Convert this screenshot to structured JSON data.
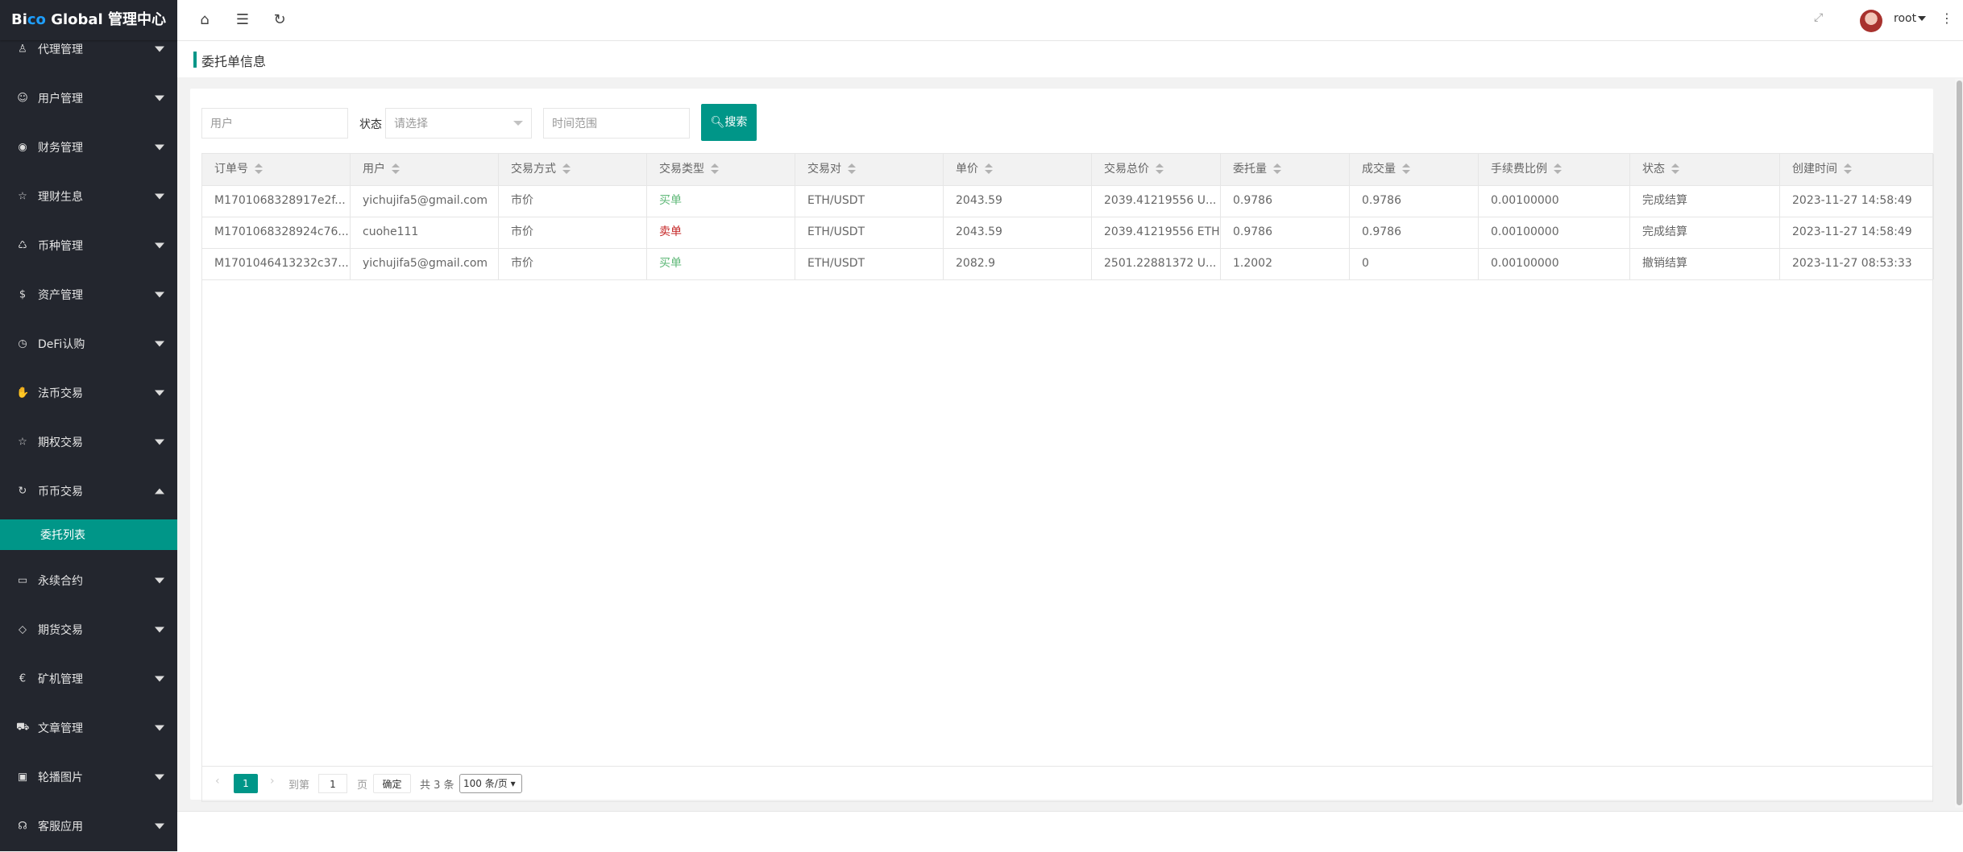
{
  "app": {
    "logo_prefix": "Bi",
    "logo_accent": "co",
    "logo_suffix": " Global 管理中心",
    "user": "root"
  },
  "sidebar": {
    "items": [
      {
        "label": "代理管理",
        "icon": "user-icon"
      },
      {
        "label": "用户管理",
        "icon": "users-icon"
      },
      {
        "label": "财务管理",
        "icon": "finance-icon"
      },
      {
        "label": "理财生息",
        "icon": "star-icon"
      },
      {
        "label": "币种管理",
        "icon": "coin-icon"
      },
      {
        "label": "资产管理",
        "icon": "dollar-icon"
      },
      {
        "label": "DeFi认购",
        "icon": "clock-icon"
      },
      {
        "label": "法币交易",
        "icon": "hand-icon"
      },
      {
        "label": "期权交易",
        "icon": "star-icon"
      },
      {
        "label": "币币交易",
        "icon": "refresh-icon",
        "expanded": true
      },
      {
        "label": "永续合约",
        "icon": "document-icon"
      },
      {
        "label": "期货交易",
        "icon": "diamond-icon"
      },
      {
        "label": "矿机管理",
        "icon": "euro-icon"
      },
      {
        "label": "文章管理",
        "icon": "car-icon"
      },
      {
        "label": "轮播图片",
        "icon": "image-icon"
      },
      {
        "label": "客服应用",
        "icon": "headset-icon"
      }
    ],
    "sub_active": "委托列表"
  },
  "breadcrumb": {
    "title": "委托单信息"
  },
  "search": {
    "user_placeholder": "用户",
    "state_label": "状态",
    "state_placeholder": "请选择",
    "time_placeholder": "时间范围",
    "search_button": "搜索"
  },
  "table": {
    "columns": [
      "订单号",
      "用户",
      "交易方式",
      "交易类型",
      "交易对",
      "单价",
      "交易总价",
      "委托量",
      "成交量",
      "手续费比例",
      "状态",
      "创建时间"
    ],
    "rows": [
      [
        "M1701068328917e2f...",
        "yichujifa5@gmail.com",
        "市价",
        "买单",
        "ETH/USDT",
        "2043.59",
        "2039.41219556 U...",
        "0.9786",
        "0.9786",
        "0.00100000",
        "完成结算",
        "2023-11-27 14:58:49"
      ],
      [
        "M1701068328924c76...",
        "cuohe111",
        "市价",
        "卖单",
        "ETH/USDT",
        "2043.59",
        "2039.41219556 ETH",
        "0.9786",
        "0.9786",
        "0.00100000",
        "完成结算",
        "2023-11-27 14:58:49"
      ],
      [
        "M1701046413232c37...",
        "yichujifa5@gmail.com",
        "市价",
        "买单",
        "ETH/USDT",
        "2082.9",
        "2501.22881372 U...",
        "1.2002",
        "0",
        "0.00100000",
        "撤销结算",
        "2023-11-27 08:53:33"
      ]
    ],
    "type_colors": {
      "买单": "#5fb878",
      "卖单": "#c62828"
    }
  },
  "pager": {
    "prev": "‹",
    "current": "1",
    "next": "›",
    "goto_label": "到第",
    "goto_value": "1",
    "page_label": "页",
    "confirm": "确定",
    "total": "共 3 条",
    "page_size": "100 条/页"
  },
  "colors": {
    "accent": "#009688",
    "sidebar_bg": "#23262e"
  }
}
